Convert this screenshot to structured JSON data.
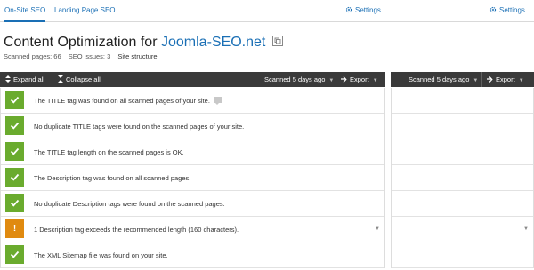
{
  "tabs": [
    {
      "label": "On-Site SEO",
      "active": true
    },
    {
      "label": "Landing Page SEO",
      "active": false
    }
  ],
  "settings_label": "Settings",
  "header": {
    "title_prefix": "Content Optimization for",
    "domain": "Joomla-SEO.net",
    "scanned_pages": "Scanned pages: 66",
    "seo_issues": "SEO issues: 3",
    "site_structure": "Site structure"
  },
  "toolbar": {
    "expand_all": "Expand all",
    "collapse_all": "Collapse all",
    "scanned": "Scanned 5 days ago",
    "export": "Export"
  },
  "toolbar_right": {
    "scanned": "Scanned 5 days ago",
    "export": "Export"
  },
  "rows": [
    {
      "status": "ok",
      "text": "The TITLE tag was found on all scanned pages of your site."
    },
    {
      "status": "ok",
      "text": "No duplicate TITLE tags were found on the scanned pages of your site."
    },
    {
      "status": "ok",
      "text": "The TITLE tag length on the scanned pages is OK."
    },
    {
      "status": "ok",
      "text": "The Description tag was found on all scanned pages."
    },
    {
      "status": "ok",
      "text": "No duplicate Description tags were found on the scanned pages."
    },
    {
      "status": "warning",
      "text": "1 Description tag exceeds the recommended length (160 characters)."
    },
    {
      "status": "ok",
      "text": "The XML Sitemap file was found on your site."
    }
  ],
  "colors": {
    "accent": "#1a6fb5",
    "ok": "#6aab2e",
    "warning": "#e08a10",
    "toolbar": "#3a3a3a"
  }
}
